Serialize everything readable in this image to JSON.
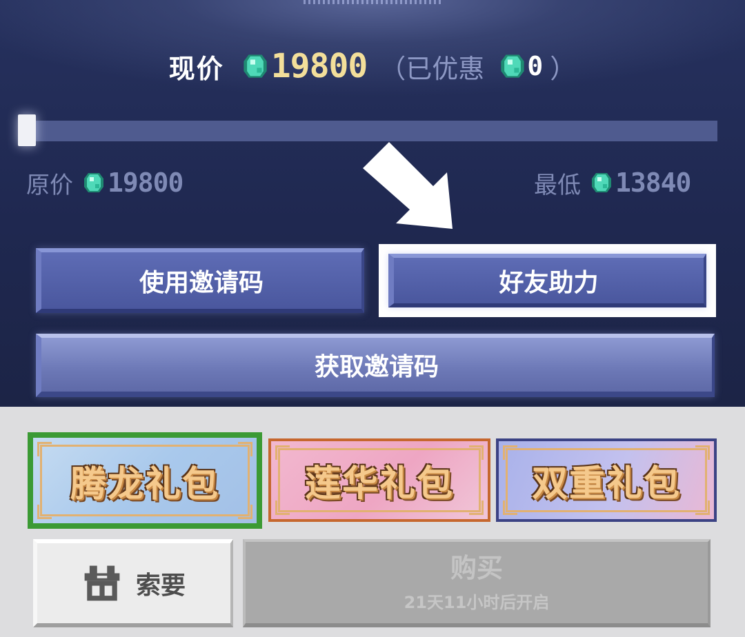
{
  "price": {
    "current_label": "现价",
    "current_value": "19800",
    "discount_open": "（",
    "discount_label": "已优惠",
    "discount_value": "0",
    "discount_close": "）",
    "original_label": "原价",
    "original_value": "19800",
    "lowest_label": "最低",
    "lowest_value": "13840",
    "progress_fraction": 0
  },
  "buttons": {
    "use_invite_code": "使用邀请码",
    "friend_help": "好友助力",
    "get_invite_code": "获取邀请码"
  },
  "packs": [
    {
      "label": "腾龙礼包",
      "selected": true
    },
    {
      "label": "莲华礼包",
      "selected": false
    },
    {
      "label": "双重礼包",
      "selected": false
    }
  ],
  "actions": {
    "ask_label": "索要",
    "buy_label": "购买",
    "buy_sub": "21天11小时后开启"
  },
  "icons": {
    "currency": "diamond-icon",
    "ask": "gift-box-icon",
    "pointer": "arrow-icon"
  },
  "colors": {
    "price_highlight": "#f3df9a",
    "panel_bg": "#222b55",
    "button_blue": "#4f5ca4",
    "selected_outline": "#3b9a34"
  }
}
